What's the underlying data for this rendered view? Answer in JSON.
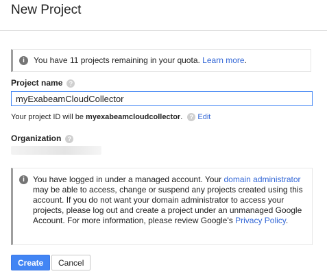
{
  "dialog": {
    "title": "New Project",
    "quota_notice": {
      "icon": "info-icon",
      "text": "You have 11 projects remaining in your quota.",
      "link": "Learn more",
      "suffix": "."
    },
    "project_name": {
      "label": "Project name",
      "help_icon": "help-icon",
      "value": "myExabeamCloudCollector"
    },
    "project_id": {
      "prefix": "Your project ID will be",
      "id": "myexabeamcloudcollector",
      "suffix": ".",
      "edit_label": "Edit"
    },
    "organization": {
      "label": "Organization",
      "help_icon": "help-icon"
    },
    "managed_notice": {
      "icon": "info-icon",
      "text_1": "You have logged in under a managed account. Your",
      "link_1": "domain administrator",
      "text_2": "may be able to access, change or suspend any projects created using this account. If you do not want your domain administrator to access your projects, please log out and create a project under an unmanaged Google Account. For more information, please review Google's",
      "link_2": "Privacy Policy",
      "text_3": "."
    },
    "buttons": {
      "create": "Create",
      "cancel": "Cancel"
    },
    "colors": {
      "primary": "#4285f4",
      "link": "#3367d6",
      "notice_border": "#9e9e9e"
    }
  }
}
